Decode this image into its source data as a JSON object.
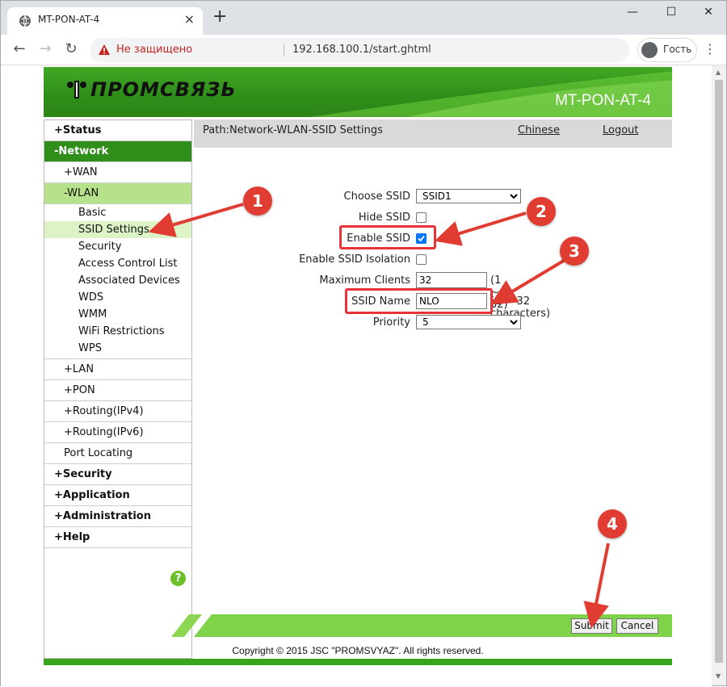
{
  "browser": {
    "tab_title": "MT-PON-AT-4",
    "tab_icon": "globe-icon",
    "insecure_label": "Не защищено",
    "url": "192.168.100.1/start.ghtml",
    "profile_label": "Гость",
    "accent": "#dee1e6",
    "warning_color": "#c5221f"
  },
  "router": {
    "brand": "ПРОМСВЯЗЬ",
    "model": "MT-PON-AT-4",
    "brand_color": "#2f8f1a",
    "path": "Path:Network-WLAN-SSID Settings",
    "link_chinese": "Chinese",
    "link_logout": "Logout",
    "copyright": "Copyright © 2015 JSC \"PROMSVYAZ\". All rights reserved."
  },
  "sidebar": {
    "status": "+Status",
    "network": "-Network",
    "wan": "+WAN",
    "wlan": "-WLAN",
    "basic": "Basic",
    "ssid_settings": "SSID Settings",
    "security_sub": "Security",
    "acl": "Access Control List",
    "associated": "Associated Devices",
    "wds": "WDS",
    "wmm": "WMM",
    "wifi_restrictions": "WiFi Restrictions",
    "wps": "WPS",
    "lan": "+LAN",
    "pon": "+PON",
    "routing4": "+Routing(IPv4)",
    "routing6": "+Routing(IPv6)",
    "port_locating": "Port Locating",
    "security": "+Security",
    "application": "+Application",
    "administration": "+Administration",
    "help": "+Help",
    "help_icon_label": "?"
  },
  "form": {
    "choose_ssid_label": "Choose SSID",
    "choose_ssid_value": "SSID1",
    "hide_ssid_label": "Hide SSID",
    "hide_ssid_checked": false,
    "enable_ssid_label": "Enable SSID",
    "enable_ssid_checked": true,
    "isolation_label": "Enable SSID Isolation",
    "isolation_checked": false,
    "max_clients_label": "Maximum Clients",
    "max_clients_value": "32",
    "max_clients_hint": "(1 ~ 32)",
    "ssid_name_label": "SSID Name",
    "ssid_name_value": "NLO",
    "ssid_name_hint": "(1 ~ 32 characters)",
    "priority_label": "Priority",
    "priority_value": "5",
    "submit_label": "Submit",
    "cancel_label": "Cancel"
  },
  "annotations": {
    "marker_1": "1",
    "marker_2": "2",
    "marker_3": "3",
    "marker_4": "4",
    "marker_color": "#e03c31"
  }
}
